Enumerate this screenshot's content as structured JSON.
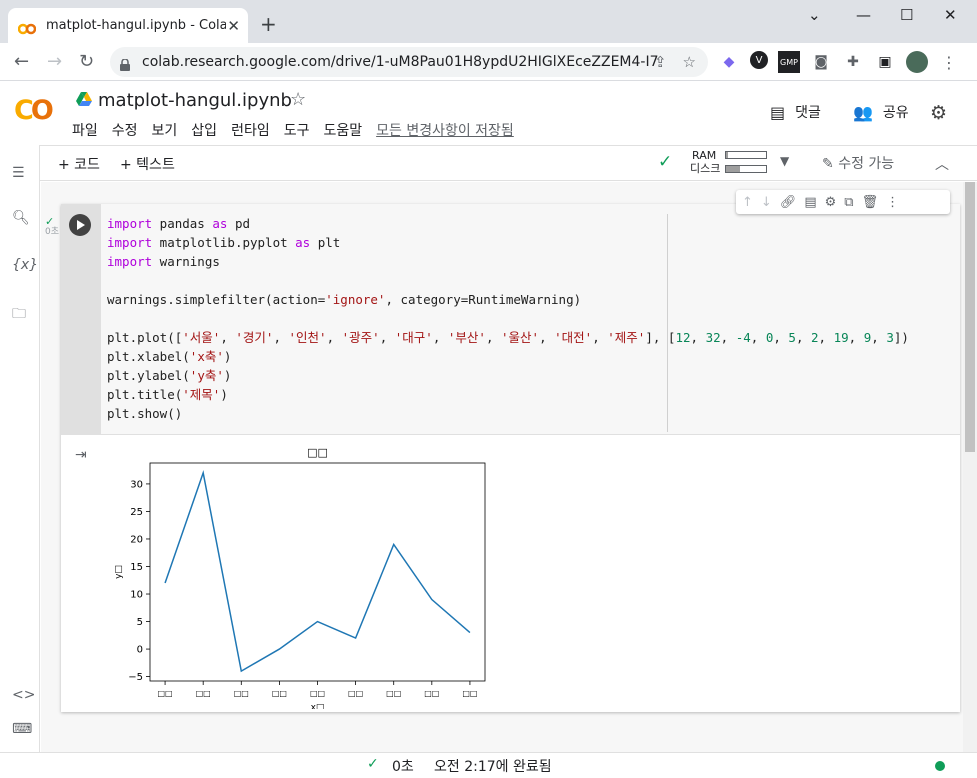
{
  "browser": {
    "tab_title": "matplot-hangul.ipynb - Colabora",
    "url": "colab.research.google.com/drive/1-uM8Pau01H8ypdU2HIGlXEceZZEM4-I7",
    "new_tab": "+",
    "close": "✕",
    "minimize": "—",
    "maximize": "☐",
    "win_close": "✕",
    "ext_gmp": "GMP"
  },
  "colab": {
    "notebook_title": "matplot-hangul.ipynb",
    "menu": [
      "파일",
      "수정",
      "보기",
      "삽입",
      "런타임",
      "도구",
      "도움말"
    ],
    "saved_status": "모든 변경사항이 저장됨",
    "comment_label": "댓글",
    "share_label": "공유",
    "add_code": "+ 코드",
    "add_text": "+ 텍스트",
    "ram_label": "RAM",
    "disk_label": "디스크",
    "ram_fraction": 0.05,
    "disk_fraction": 0.35,
    "edit_label": "수정 가능"
  },
  "cell": {
    "exec_time": "0초",
    "code_lines": [
      [
        [
          "kw",
          "import"
        ],
        [
          "t",
          " pandas "
        ],
        [
          "kw",
          "as"
        ],
        [
          "t",
          " pd"
        ]
      ],
      [
        [
          "kw",
          "import"
        ],
        [
          "t",
          " matplotlib.pyplot "
        ],
        [
          "kw",
          "as"
        ],
        [
          "t",
          " plt"
        ]
      ],
      [
        [
          "kw",
          "import"
        ],
        [
          "t",
          " warnings"
        ]
      ],
      [],
      [
        [
          "t",
          "warnings.simplefilter(action="
        ],
        [
          "str",
          "'ignore'"
        ],
        [
          "t",
          ", category=RuntimeWarning)"
        ]
      ],
      [],
      [
        [
          "t",
          "plt.plot(["
        ],
        [
          "str",
          "'서울'"
        ],
        [
          "t",
          ", "
        ],
        [
          "str",
          "'경기'"
        ],
        [
          "t",
          ", "
        ],
        [
          "str",
          "'인천'"
        ],
        [
          "t",
          ", "
        ],
        [
          "str",
          "'광주'"
        ],
        [
          "t",
          ", "
        ],
        [
          "str",
          "'대구'"
        ],
        [
          "t",
          ", "
        ],
        [
          "str",
          "'부산'"
        ],
        [
          "t",
          ", "
        ],
        [
          "str",
          "'울산'"
        ],
        [
          "t",
          ", "
        ],
        [
          "str",
          "'대전'"
        ],
        [
          "t",
          ", "
        ],
        [
          "str",
          "'제주'"
        ],
        [
          "t",
          "], ["
        ],
        [
          "num",
          "12"
        ],
        [
          "t",
          ", "
        ],
        [
          "num",
          "32"
        ],
        [
          "t",
          ", "
        ],
        [
          "num",
          "-4"
        ],
        [
          "t",
          ", "
        ],
        [
          "num",
          "0"
        ],
        [
          "t",
          ", "
        ],
        [
          "num",
          "5"
        ],
        [
          "t",
          ", "
        ],
        [
          "num",
          "2"
        ],
        [
          "t",
          ", "
        ],
        [
          "num",
          "19"
        ],
        [
          "t",
          ", "
        ],
        [
          "num",
          "9"
        ],
        [
          "t",
          ", "
        ],
        [
          "num",
          "3"
        ],
        [
          "t",
          "])"
        ]
      ],
      [
        [
          "t",
          "plt.xlabel("
        ],
        [
          "str",
          "'x축'"
        ],
        [
          "t",
          ")"
        ]
      ],
      [
        [
          "t",
          "plt.ylabel("
        ],
        [
          "str",
          "'y축'"
        ],
        [
          "t",
          ")"
        ]
      ],
      [
        [
          "t",
          "plt.title("
        ],
        [
          "str",
          "'제목'"
        ],
        [
          "t",
          ")"
        ]
      ],
      [
        [
          "t",
          "plt.show()"
        ]
      ]
    ]
  },
  "chart_data": {
    "type": "line",
    "categories": [
      "□□",
      "□□",
      "□□",
      "□□",
      "□□",
      "□□",
      "□□",
      "□□",
      "□□"
    ],
    "values": [
      12,
      32,
      -4,
      0,
      5,
      2,
      19,
      9,
      3
    ],
    "title": "□□",
    "xlabel": "x□",
    "ylabel": "y□",
    "ylim": [
      -5.8,
      33.8
    ],
    "yticks": [
      -5,
      0,
      5,
      10,
      15,
      20,
      25,
      30
    ],
    "line_color": "#1f77b4"
  },
  "footer": {
    "check": "✓",
    "time": "0초",
    "done": "오전 2:17에 완료됨"
  }
}
